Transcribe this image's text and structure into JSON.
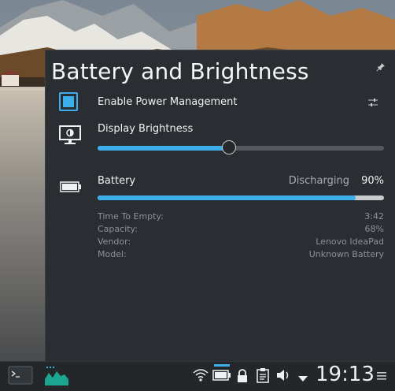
{
  "popup": {
    "title": "Battery and Brightness",
    "power_management": {
      "label": "Enable Power Management",
      "checked": true
    },
    "brightness": {
      "label": "Display Brightness",
      "level": 0.46
    },
    "battery": {
      "label": "Battery",
      "status": "Discharging",
      "percent_text": "90%",
      "charge": 0.9,
      "details": [
        {
          "key": "Time To Empty:",
          "value": "3:42"
        },
        {
          "key": "Capacity:",
          "value": "68%"
        },
        {
          "key": "Vendor:",
          "value": "Lenovo IdeaPad"
        },
        {
          "key": "Model:",
          "value": "Unknown Battery"
        }
      ]
    }
  },
  "taskbar": {
    "clock": "19:13"
  },
  "icons": {
    "pin": "pin-icon",
    "monitor": "monitor-brightness-icon",
    "battery": "battery-icon",
    "settings": "settings-sliders-icon",
    "terminal": "terminal-icon",
    "monitor_app": "system-monitor-icon",
    "wifi": "wifi-icon",
    "tray_battery": "battery-tray-icon",
    "lock": "lock-icon",
    "clipboard": "clipboard-icon",
    "volume": "volume-icon",
    "expand": "expand-tray-icon",
    "menu": "hamburger-menu-icon"
  },
  "colors": {
    "accent": "#3daee9",
    "panel": "#2a2e32",
    "taskbar": "#24272a"
  }
}
